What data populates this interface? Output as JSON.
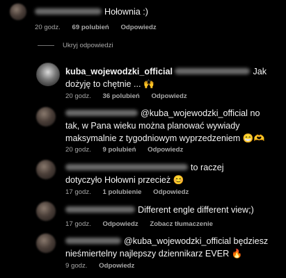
{
  "comments": [
    {
      "text": "Hołownia :)",
      "time": "20 godz.",
      "likes": "69 polubień",
      "reply": "Odpowiedz"
    }
  ],
  "toggle_replies": "Ukryj odpowiedzi",
  "replies": [
    {
      "username": "kuba_wojewodzki_official",
      "text": "Jak dożyję to chętnie ... 🙌",
      "time": "20 godz.",
      "likes": "36 polubień",
      "reply": "Odpowiedz"
    },
    {
      "text": "@kuba_wojewodzki_official no tak, w Pana wieku można planować wywiady maksymalnie z tygodniowym wyprzedzeniem 😁🫶",
      "time": "20 godz.",
      "likes": "9 polubień",
      "reply": "Odpowiedz"
    },
    {
      "text": "to raczej dotyczyło Hołowni przecież 😊",
      "time": "17 godz.",
      "likes": "1 polubienie",
      "reply": "Odpowiedz"
    },
    {
      "text": "Different engle different view;)",
      "time": "17 godz.",
      "reply": "Odpowiedz",
      "translate": "Zobacz tłumaczenie"
    },
    {
      "text": "@kuba_wojewodzki_official będziesz nieśmiertelny najlepszy dziennikarz EVER 🔥",
      "time": "9 godz.",
      "reply": "Odpowiedz"
    }
  ]
}
